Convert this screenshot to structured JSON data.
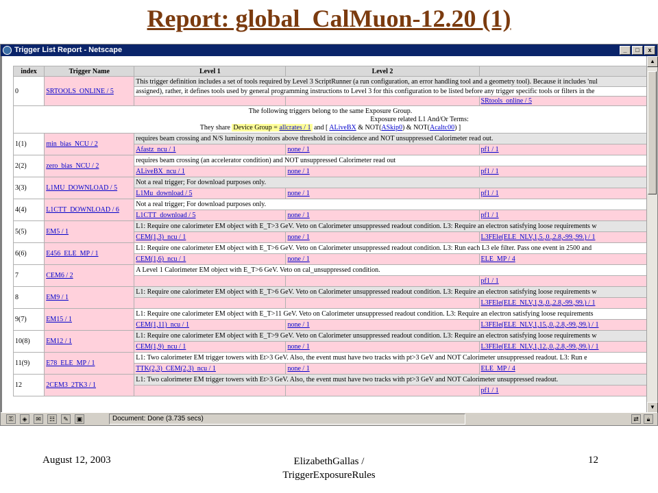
{
  "slide": {
    "title": "Report: global_CalMuon-12.20 (1)",
    "footer_date": "August 12, 2003",
    "footer_author_line1": "ElizabethGallas /",
    "footer_author_line2": "TriggerExposureRules",
    "footer_page": "12"
  },
  "window": {
    "title": "Trigger List Report - Netscape",
    "btn_min": "_",
    "btn_max": "□",
    "btn_close": "x",
    "status": "Document: Done (3.735 secs)"
  },
  "table": {
    "headers": [
      "index",
      "Trigger Name",
      "Level 1",
      "Level 2"
    ],
    "row0": {
      "idx": "0",
      "name": "SRTOOLS_ONLINE / 5",
      "desc": "This trigger definition includes a set of tools required by Level 3 ScriptRunner (a run configuration, an error handling tool and a geometry tool). Because it includes 'nul",
      "desc2": "assigned), rather, it defines tools used by general programming instructions to Level 3 for this configuration to be listed before any trigger specific tools or filters in the",
      "l3": "SRtools_online / 5"
    },
    "group": {
      "line1": "The following triggers belong to the same Exposure Group.",
      "line2_prefix": "Exposure related L1 And/Or Terms:",
      "share_prefix": "They share",
      "share_hl": "Device Group =",
      "share_link": "allcrates / 1",
      "share_and": "and",
      "terms_open": "[",
      "term1": "ALiveBX",
      "and_not1": "& NOT(",
      "term2": "ASkip0",
      "and_not2": ") & NOT(",
      "term3": "Acaltc00",
      "terms_close": ") ]"
    },
    "rows": [
      {
        "idx": "1(1)",
        "name": "min_bias_NCU / 2",
        "desc": "requires beam crossing and N/S luminosity monitors above threshold in coincidence and NOT unsuppressed Calorimeter read out.",
        "l1": "Afastz_ncu / 1",
        "l2": "none / 1",
        "l3": "pf1 / 1",
        "style": "gray"
      },
      {
        "idx": "2(2)",
        "name": "zero_bias_NCU / 2",
        "desc": "requires beam crossing (an accelerator condition) and NOT unsuppressed Calorimeter read out",
        "l1": "ALiveBX_ncu / 1",
        "l2": "none / 1",
        "l3": "pf1 / 1",
        "style": "white"
      },
      {
        "idx": "3(3)",
        "name": "L1MU_DOWNLOAD / 5",
        "desc": "Not a real trigger; For download purposes only.",
        "l1": "L1Mu_download / 5",
        "l2": "none / 1",
        "l3": "pf1 / 1",
        "style": "gray"
      },
      {
        "idx": "4(4)",
        "name": "L1CTT_DOWNLOAD / 6",
        "desc": "Not a real trigger; For download purposes only.",
        "l1": "L1CTT_download / 5",
        "l2": "none / 1",
        "l3": "pf1 / 1",
        "style": "white"
      },
      {
        "idx": "5(5)",
        "name": "EM5 / 1",
        "desc": "L1: Require one calorimeter EM object with E_T>3 GeV. Veto on Calorimeter unsuppressed readout condition. L3: Require an electron satisfying loose requirements w",
        "l1": "CEM(1,3)_ncu / 1",
        "l2": "none / 1",
        "l3": "L3FEle(ELE_NLV,1,5.,0.,2.8,-99.,99.) / 1",
        "style": "gray"
      },
      {
        "idx": "6(6)",
        "name": "E456_ELE_MP / 1",
        "desc": "L1: Require one calorimeter EM object with E_T>6 GeV. Veto on Calorimeter unsuppressed readout condition. L3: Run each L3 ele filter. Pass one event in 2500 and",
        "l1": "CEM(1,6)_ncu / 1",
        "l2": "none / 1",
        "l3": "ELE_MP / 4",
        "style": "white"
      },
      {
        "idx": "7",
        "name": "CEM6 / 2",
        "desc": "A Level 1 Calorimeter EM object with E_T>6 GeV. Veto on cal_unsuppressed condition.",
        "l1": "",
        "l2": "",
        "l3": "pf1 / 1",
        "style": "white"
      },
      {
        "idx": "8",
        "name": "EM9 / 1",
        "desc": "L1: Require one calorimeter EM object with E_T>6 GeV. Veto on Calorimeter unsuppressed readout condition. L3: Require an electron satisfying loose requirements w",
        "l1": "",
        "l2": "",
        "l3": "L3FEle(ELE_NLV,1,9.,0.,2.8,-99.,99.) / 1",
        "style": "gray"
      },
      {
        "idx": "9(7)",
        "name": "EM15 / 1",
        "desc": "L1: Require one calorimeter EM object with E_T>11 GeV. Veto on Calorimeter unsuppressed readout condition. L3: Require an electron satisfying loose requirements",
        "l1": "CEM(1,11)_ncu / 1",
        "l2": "none / 1",
        "l3": "L3FEle(ELE_NLV,1,15.,0.,2.8,-99.,99.) / 1",
        "style": "white"
      },
      {
        "idx": "10(8)",
        "name": "EM12 / 1",
        "desc": "L1: Require one calorimeter EM object with E_T>9 GeV. Veto on Calorimeter unsuppressed readout condition. L3: Require an electron satisfying loose requirements w",
        "l1": "CEM(1,9)_ncu / 1",
        "l2": "none / 1",
        "l3": "L3FEle(ELE_NLV,1,12.,0.,2.8,-99.,99.) / 1",
        "style": "gray"
      },
      {
        "idx": "11(9)",
        "name": "E78_ELE_MP / 1",
        "desc": "L1: Two calorimeter EM trigger towers with Et>3 GeV. Also, the event must have two tracks with pt>3 GeV and NOT Calorimeter unsuppressed readout. L3: Run e",
        "l1": "TTK(2,3)_CEM(2,3)_ncu / 1",
        "l2": "none / 1",
        "l3": "ELE_MP / 4",
        "style": "white"
      },
      {
        "idx": "12",
        "name": "2CEM3_2TK3 / 1",
        "desc": "L1: Two calorimeter EM trigger towers with Et>3 GeV. Also, the event must have two tracks with pt>3 GeV and NOT Calorimeter unsuppressed readout.",
        "l1": "",
        "l2": "",
        "l3": "pf1 / 1",
        "style": "gray"
      }
    ]
  }
}
